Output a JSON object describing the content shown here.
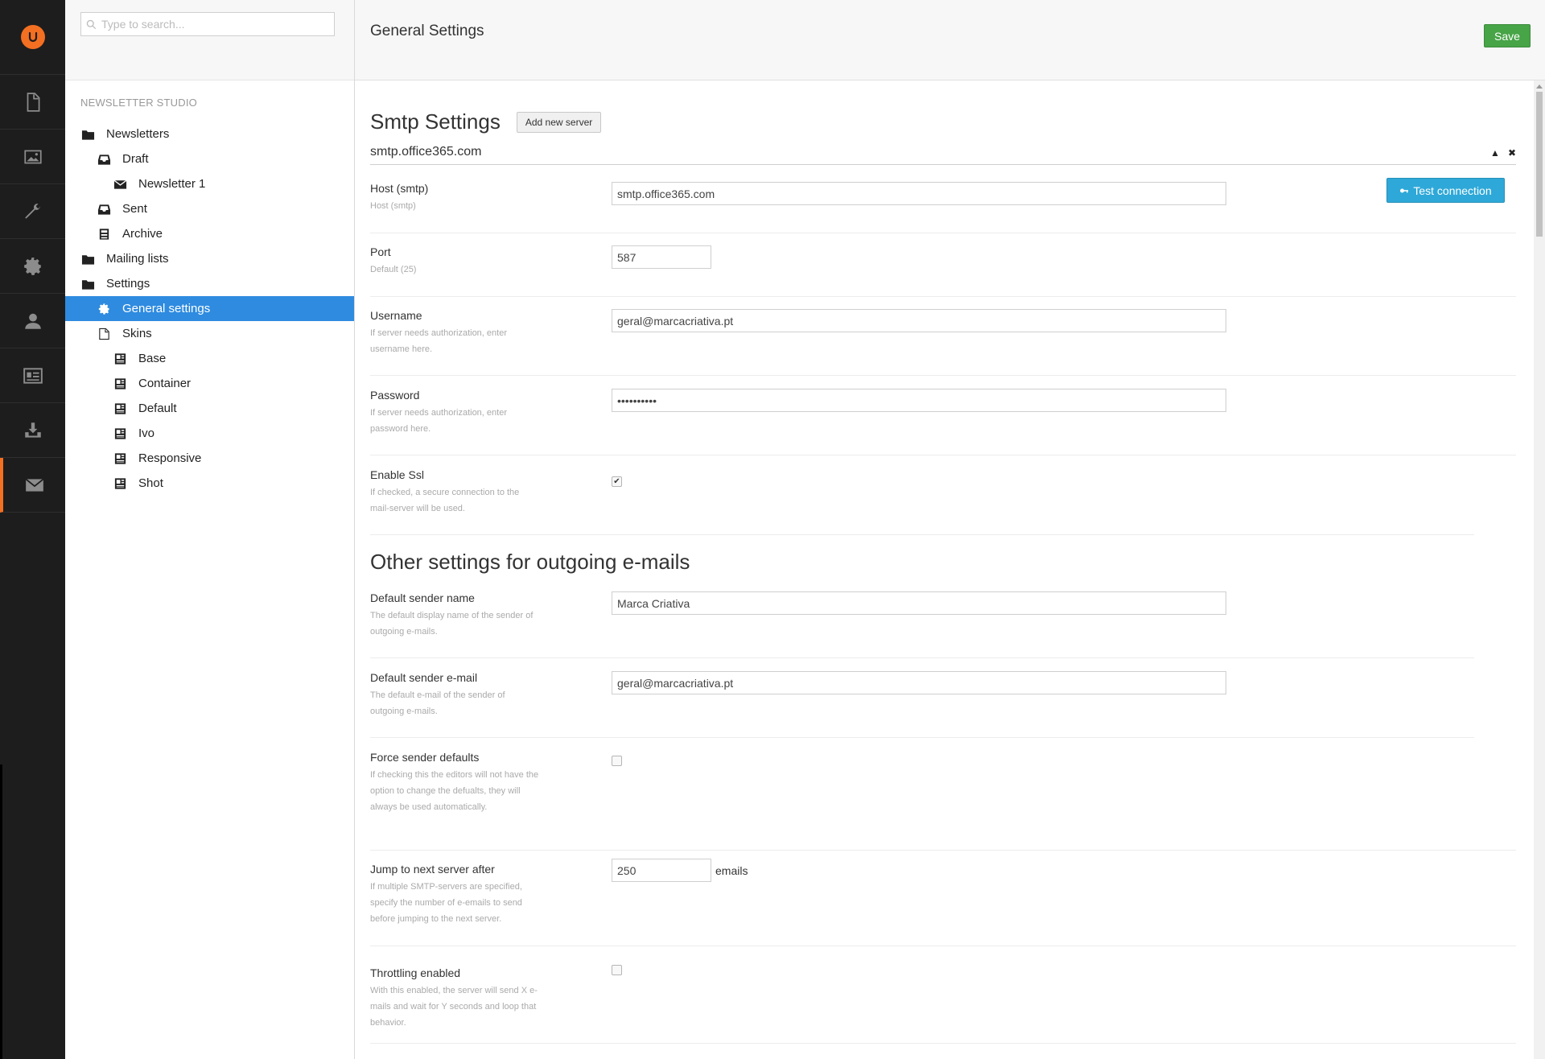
{
  "sidebar_icons": [
    {
      "name": "content-icon"
    },
    {
      "name": "media-icon"
    },
    {
      "name": "developer-icon"
    },
    {
      "name": "settings-icon"
    },
    {
      "name": "users-icon"
    },
    {
      "name": "members-icon"
    },
    {
      "name": "packages-icon"
    },
    {
      "name": "newsletter-icon"
    }
  ],
  "tree": {
    "search_placeholder": "Type to search...",
    "section_title": "NEWSLETTER STUDIO",
    "nodes": [
      {
        "label": "Newsletters",
        "icon": "folder-icon",
        "level": 0
      },
      {
        "label": "Draft",
        "icon": "inbox-icon",
        "level": 1
      },
      {
        "label": "Newsletter 1",
        "icon": "envelope-icon",
        "level": 2
      },
      {
        "label": "Sent",
        "icon": "tray-icon",
        "level": 1
      },
      {
        "label": "Archive",
        "icon": "archive-icon",
        "level": 1
      },
      {
        "label": "Mailing lists",
        "icon": "folder-icon",
        "level": 0
      },
      {
        "label": "Settings",
        "icon": "folder-icon",
        "level": 0
      },
      {
        "label": "General settings",
        "icon": "gear-icon",
        "level": 1,
        "active": true
      },
      {
        "label": "Skins",
        "icon": "document-icon",
        "level": 1
      },
      {
        "label": "Base",
        "icon": "layout-icon",
        "level": 2
      },
      {
        "label": "Container",
        "icon": "layout-icon",
        "level": 2
      },
      {
        "label": "Default",
        "icon": "layout-icon",
        "level": 2
      },
      {
        "label": "Ivo",
        "icon": "layout-icon",
        "level": 2
      },
      {
        "label": "Responsive",
        "icon": "layout-icon",
        "level": 2
      },
      {
        "label": "Shot",
        "icon": "layout-icon",
        "level": 2
      }
    ]
  },
  "header": {
    "title": "General Settings",
    "save_label": "Save"
  },
  "smtp": {
    "heading": "Smtp Settings",
    "add_server_label": "Add new server",
    "server_name": "smtp.office365.com",
    "collapse_glyph": "▲",
    "remove_glyph": "✖",
    "test_connection_label": "Test connection",
    "host": {
      "label": "Host (smtp)",
      "help": "Host (smtp)",
      "value": "smtp.office365.com"
    },
    "port": {
      "label": "Port",
      "help": "Default (25)",
      "value": "587"
    },
    "username": {
      "label": "Username",
      "help": "If server needs authorization, enter username here.",
      "value": "geral@marcacriativa.pt"
    },
    "password": {
      "label": "Password",
      "help": "If server needs authorization, enter password here.",
      "value": "••••••••••"
    },
    "ssl": {
      "label": "Enable Ssl",
      "help": "If checked, a secure connection to the mail-server will be used.",
      "checked": true
    }
  },
  "other": {
    "heading": "Other settings for outgoing e-mails",
    "sender_name": {
      "label": "Default sender name",
      "help": "The default display name of the sender of outgoing e-mails.",
      "value": "Marca Criativa"
    },
    "sender_email": {
      "label": "Default sender e-mail",
      "help": "The default e-mail of the sender of outgoing e-mails.",
      "value": "geral@marcacriativa.pt"
    },
    "force_defaults": {
      "label": "Force sender defaults",
      "help": "If checking this the editors will not have the option to change the defualts, they will always be used automatically.",
      "checked": false
    },
    "jump_server": {
      "label": "Jump to next server after",
      "help": "If multiple SMTP-servers are specified, specify the number of e-emails to send before jumping to the next server.",
      "value": "250",
      "unit": "emails"
    },
    "throttling": {
      "label": "Throttling enabled",
      "help": "With this enabled, the server will send X e-mails and wait for Y seconds and loop that behavior.",
      "checked": false
    }
  },
  "colors": {
    "accent": "#f36f21",
    "active_node": "#2e8be0",
    "save": "#47a447",
    "test_connection": "#2ea8d8"
  }
}
